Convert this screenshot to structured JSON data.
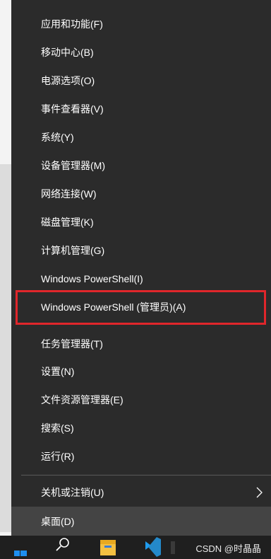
{
  "menu": {
    "items": [
      {
        "label": "应用和功能(F)"
      },
      {
        "label": "移动中心(B)"
      },
      {
        "label": "电源选项(O)"
      },
      {
        "label": "事件查看器(V)"
      },
      {
        "label": "系统(Y)"
      },
      {
        "label": "设备管理器(M)"
      },
      {
        "label": "网络连接(W)"
      },
      {
        "label": "磁盘管理(K)"
      },
      {
        "label": "计算机管理(G)"
      },
      {
        "label": "Windows PowerShell(I)"
      },
      {
        "label": "Windows PowerShell (管理员)(A)",
        "highlighted": true
      },
      {
        "label": "任务管理器(T)"
      },
      {
        "label": "设置(N)"
      },
      {
        "label": "文件资源管理器(E)"
      },
      {
        "label": "搜索(S)"
      },
      {
        "label": "运行(R)"
      },
      {
        "label": "关机或注销(U)",
        "has_submenu": true
      },
      {
        "label": "桌面(D)",
        "hovered": true
      }
    ]
  },
  "taskbar": {
    "icons": [
      "windows-start-icon",
      "search-icon",
      "file-explorer-icon",
      "vscode-icon"
    ],
    "watermark": "CSDN @时晶晶"
  },
  "colors": {
    "menu_bg": "#2b2b2b",
    "menu_hover": "#444444",
    "highlight_border": "#e0262b",
    "taskbar_bg": "#1f1f1f",
    "start_blue": "#1e8ef0"
  }
}
